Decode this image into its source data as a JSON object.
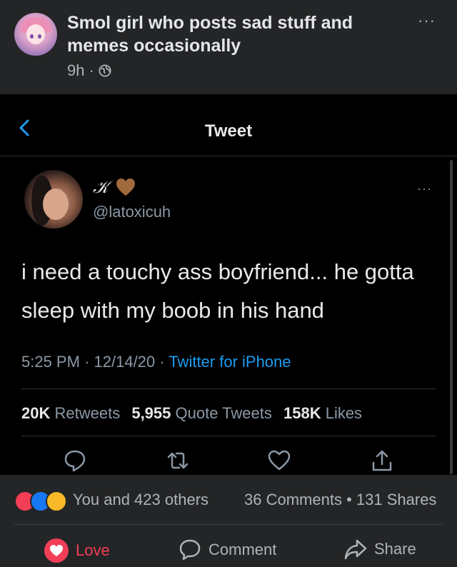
{
  "post": {
    "author": "Smol girl who posts sad stuff and memes occasionally",
    "time": "9h",
    "dot": "·",
    "more": "···"
  },
  "tweet": {
    "title": "Tweet",
    "name": "𝒦",
    "handle": "@latoxicuh",
    "more": "···",
    "text": "i need a touchy ass boyfriend... he gotta sleep with my boob in his hand",
    "time": "5:25 PM",
    "date": "12/14/20",
    "source": "Twitter for iPhone",
    "meta_sep": "·",
    "retweets_count": "20K",
    "retweets_label": "Retweets",
    "quotes_count": "5,955",
    "quotes_label": "Quote Tweets",
    "likes_count": "158K",
    "likes_label": "Likes",
    "accent_color": "#1d9bf0"
  },
  "reactions": {
    "summary": "You and 423 others",
    "comments": "36 Comments",
    "sep": "•",
    "shares": "131 Shares"
  },
  "actions": {
    "love": "Love",
    "comment": "Comment",
    "share": "Share"
  }
}
